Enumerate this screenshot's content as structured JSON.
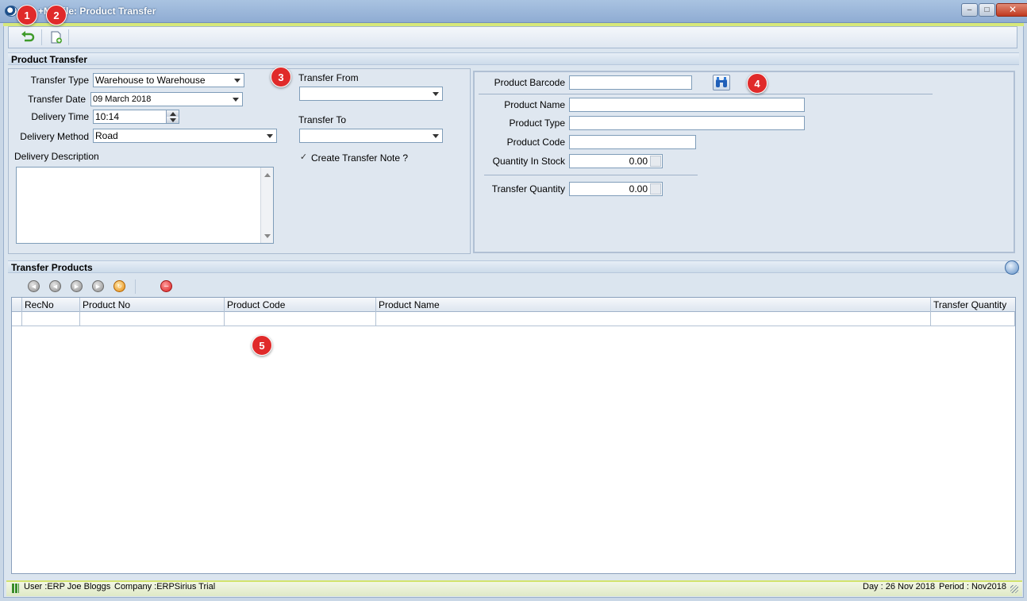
{
  "window": {
    "title": "+Mobile: Product Transfer",
    "controls": {
      "minimize": "–",
      "maximize": "□",
      "close": "✕"
    }
  },
  "toolbar": {
    "buttons": [
      {
        "name": "back-button",
        "icon": "green-return-arrow-icon"
      },
      {
        "name": "new-document-button",
        "icon": "new-document-icon"
      }
    ]
  },
  "product_transfer": {
    "header": "Product Transfer",
    "transfer_type": {
      "label": "Transfer Type",
      "value": "Warehouse to Warehouse"
    },
    "transfer_date": {
      "label": "Transfer Date",
      "value": "09 March 2018"
    },
    "delivery_time": {
      "label": "Delivery Time",
      "value": "10:14"
    },
    "delivery_method": {
      "label": "Delivery Method",
      "value": "Road"
    },
    "delivery_description": {
      "label": "Delivery Description",
      "value": ""
    },
    "transfer_from": {
      "label": "Transfer From",
      "value": ""
    },
    "transfer_to": {
      "label": "Transfer To",
      "value": ""
    },
    "create_transfer_note": {
      "label": "Create Transfer Note ?",
      "checked": true,
      "mark": "✓"
    }
  },
  "product_panel": {
    "product_barcode": {
      "label": "Product Barcode",
      "value": ""
    },
    "product_name": {
      "label": "Product Name",
      "value": ""
    },
    "product_type": {
      "label": "Product Type",
      "value": ""
    },
    "product_code": {
      "label": "Product Code",
      "value": ""
    },
    "quantity_in_stock": {
      "label": "Quantity In Stock",
      "value": "0.00"
    },
    "transfer_quantity": {
      "label": "Transfer Quantity",
      "value": "0.00"
    }
  },
  "transfer_products": {
    "header": "Transfer Products",
    "columns": [
      "RecNo",
      "Product No",
      "Product Code",
      "Product Name",
      "Transfer Quantity"
    ],
    "rows": []
  },
  "badges": [
    "1",
    "2",
    "3",
    "4",
    "5"
  ],
  "status": {
    "user": "User :ERP Joe Bloggs",
    "company": "Company :ERPSirius Trial",
    "day": "Day : 26 Nov 2018",
    "period": "Period : Nov2018"
  },
  "colors": {
    "badge": "#e02a2a",
    "accent": "#d2e36d",
    "delete": "#e02a2a"
  }
}
